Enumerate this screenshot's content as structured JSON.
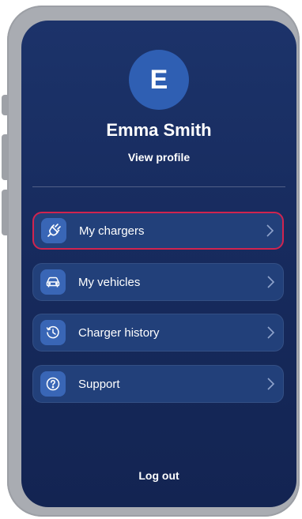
{
  "profile": {
    "initial": "E",
    "name": "Emma Smith",
    "view_profile_label": "View profile"
  },
  "menu": {
    "items": [
      {
        "label": "My chargers",
        "icon": "plug-icon",
        "highlighted": true
      },
      {
        "label": "My vehicles",
        "icon": "car-icon",
        "highlighted": false
      },
      {
        "label": "Charger history",
        "icon": "history-icon",
        "highlighted": false
      },
      {
        "label": "Support",
        "icon": "help-icon",
        "highlighted": false
      }
    ]
  },
  "footer": {
    "logout_label": "Log out"
  },
  "colors": {
    "background_top": "#1c336a",
    "background_bottom": "#132452",
    "avatar": "#2f5fb3",
    "item_bg": "#22407a",
    "icon_bg": "#3966b6",
    "highlight": "#d0244f"
  }
}
